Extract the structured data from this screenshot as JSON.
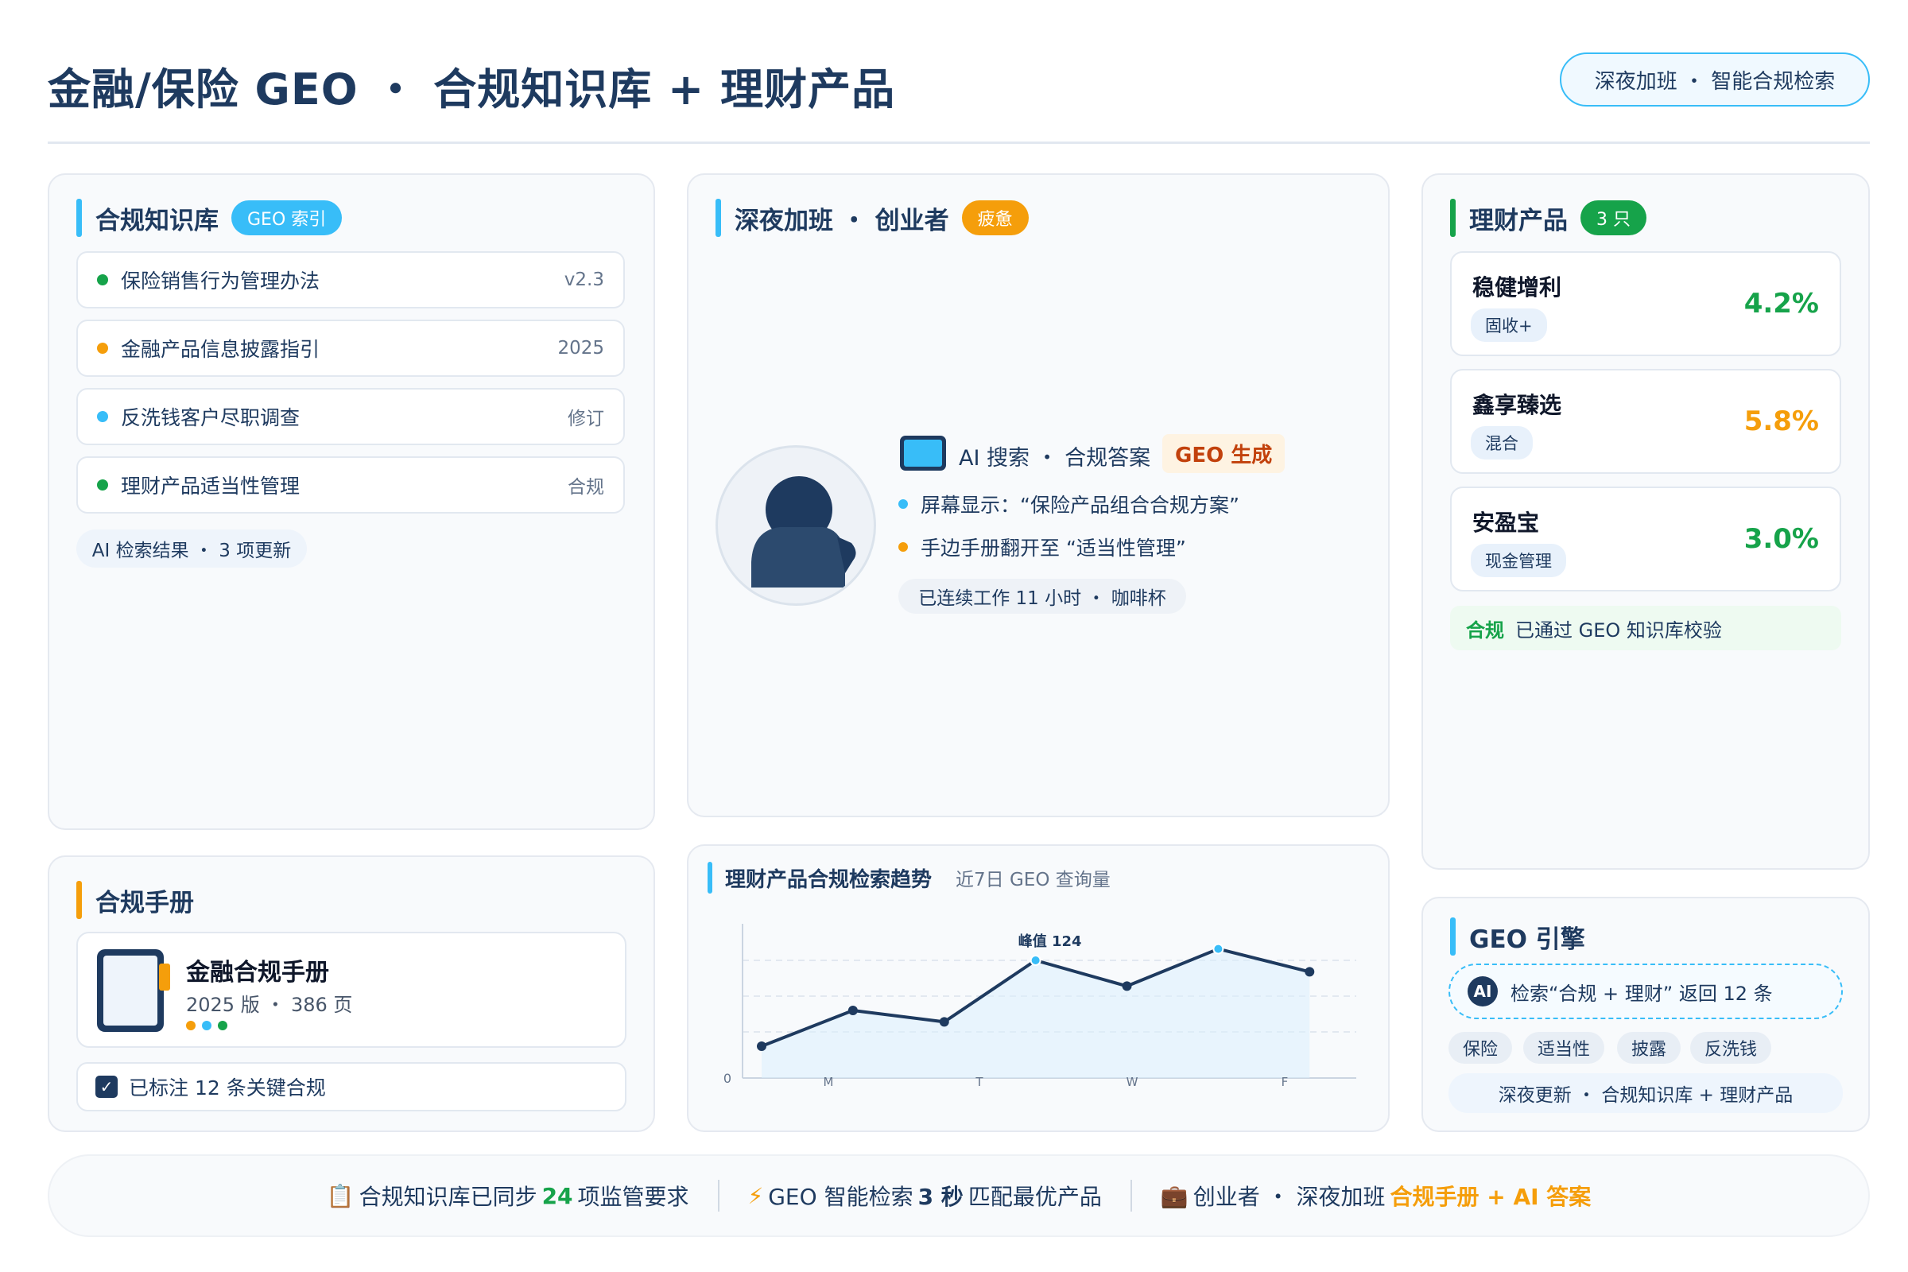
{
  "header": {
    "title": "金融/保险 GEO ・ 合规知识库 + 理财产品",
    "pill": "深夜加班 ・ 智能合规检索"
  },
  "kb": {
    "title": "合规知识库",
    "badge": "GEO 索引",
    "items": [
      {
        "label": "保险销售行为管理办法",
        "tag": "v2.3",
        "dot": "#16a34a"
      },
      {
        "label": "金融产品信息披露指引",
        "tag": "2025",
        "dot": "#f59e0b"
      },
      {
        "label": "反洗钱客户尽职调查",
        "tag": "修订",
        "dot": "#38bdf8"
      },
      {
        "label": "理财产品适当性管理",
        "tag": "合规",
        "dot": "#16a34a"
      }
    ],
    "footer": "AI 检索结果 ・ 3 项更新"
  },
  "scene": {
    "title": "深夜加班 ・ 创业者",
    "badge": "疲惫",
    "screen_label": "AI 搜索 ・ 合规答案",
    "geo_tag": "GEO 生成",
    "line1": "屏幕显示：“保险产品组合合规方案”",
    "line2": "手边手册翻开至 “适当性管理”",
    "status": "已连续工作 11 小时 ・ 咖啡杯"
  },
  "products": {
    "title": "理财产品",
    "badge": "3 只",
    "items": [
      {
        "name": "稳健增利",
        "tag": "固收+",
        "rate": "4.2%",
        "color": "#16a34a"
      },
      {
        "name": "鑫享臻选",
        "tag": "混合",
        "rate": "5.8%",
        "color": "#f59e0b"
      },
      {
        "name": "安盈宝",
        "tag": "现金管理",
        "rate": "3.0%",
        "color": "#16a34a"
      }
    ],
    "compliance_label": "合规",
    "compliance_text": "已通过 GEO 知识库校验"
  },
  "manual": {
    "title": "合规手册",
    "name": "金融合规手册",
    "meta": "2025 版 ・ 386 页",
    "checkbox_label": "已标注 12 条关键合规",
    "checkbox_mark": "✓"
  },
  "trend": {
    "title": "理财产品合规检索趋势",
    "subtitle": "近7日 GEO 查询量"
  },
  "chart_data": {
    "type": "line",
    "title": "理财产品合规检索趋势",
    "subtitle": "近7日 GEO 查询量",
    "x": [
      "",
      "M",
      "",
      "T",
      "",
      "W",
      "",
      "F"
    ],
    "tick_labels": [
      "M",
      "T",
      "W",
      "F"
    ],
    "values": [
      20,
      45,
      37,
      80,
      62,
      88,
      72
    ],
    "y_min_label": "0",
    "peak_label": "峰值 124",
    "ylim": [
      0,
      100
    ],
    "grid": true,
    "line_color": "#1e3a5f",
    "highlight_color": "#38bdf8"
  },
  "geo": {
    "title": "GEO 引擎",
    "ai_icon": "AI",
    "query": "检索“合规 + 理财” 返回 12 条",
    "chips": [
      "保险",
      "适当性",
      "披露",
      "反洗钱"
    ],
    "footer": "深夜更新 ・ 合规知识库 + 理财产品"
  },
  "footer": {
    "seg1_icon": "📋",
    "seg1_pre": "合规知识库已同步",
    "seg1_num": "24",
    "seg1_post": "项监管要求",
    "seg2_icon": "⚡",
    "seg2_pre": "GEO 智能检索",
    "seg2_num": "3 秒",
    "seg2_post": "匹配最优产品",
    "seg3_icon": "💼",
    "seg3_pre": "创业者 ・ 深夜加班",
    "seg3_em": "合规手册 + AI 答案"
  },
  "colors": {
    "accent_blue": "#38bdf8",
    "accent_green": "#16a34a",
    "accent_orange": "#f59e0b",
    "navy": "#1e3a5f"
  }
}
